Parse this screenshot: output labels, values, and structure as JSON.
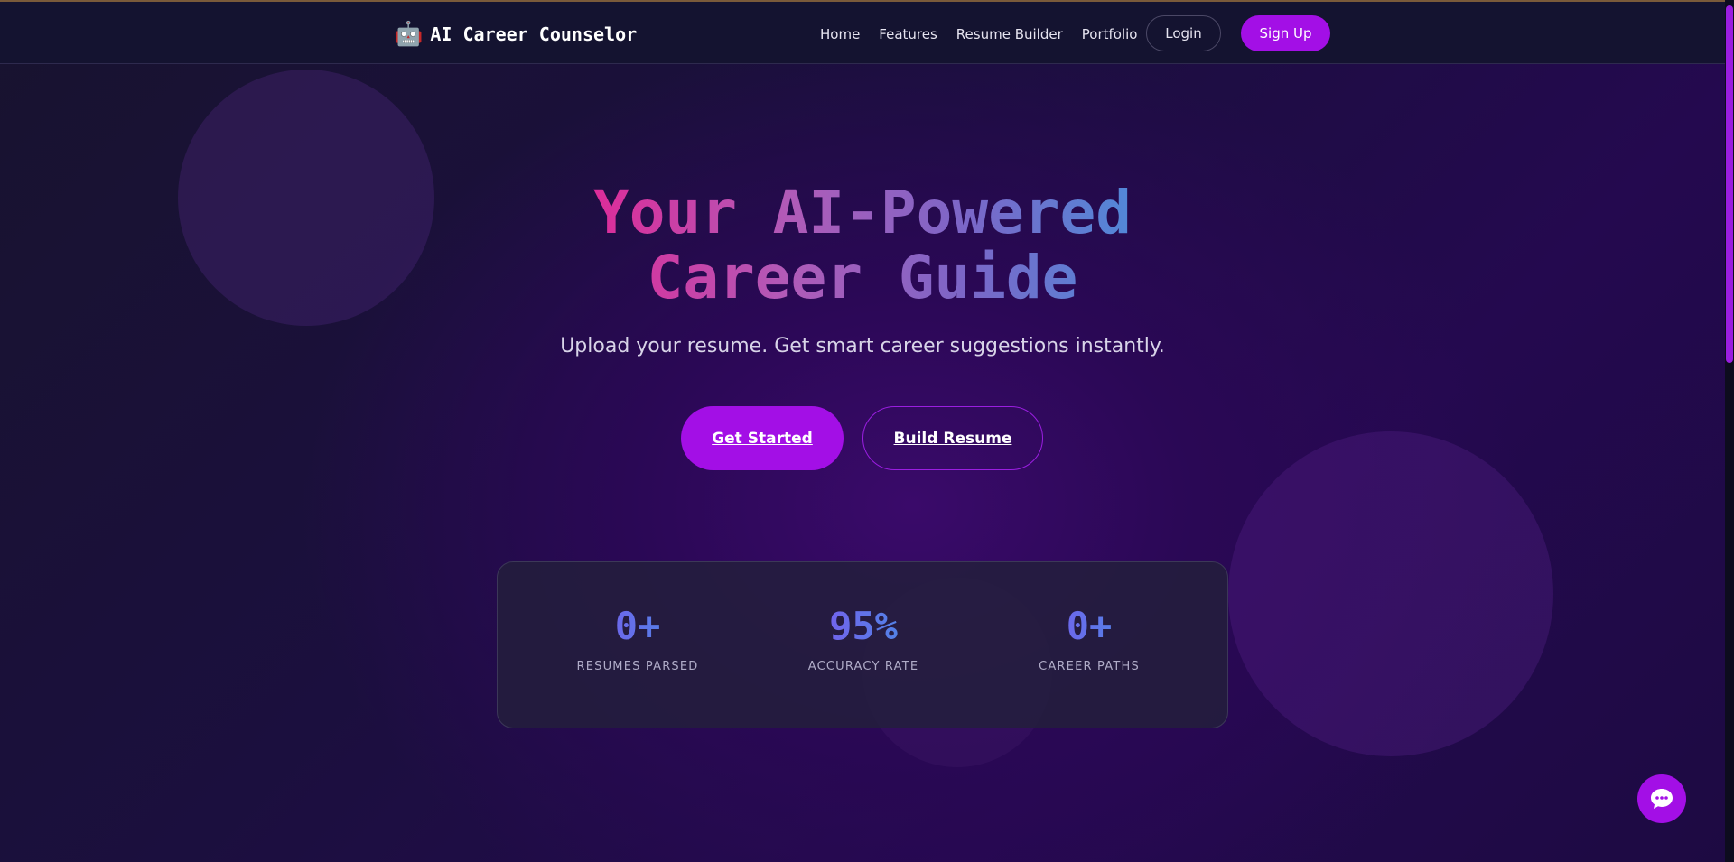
{
  "brand": {
    "icon": "robot-icon",
    "icon_glyph": "🤖",
    "name": "AI Career Counselor"
  },
  "nav": {
    "links": [
      "Home",
      "Features",
      "Resume Builder",
      "Portfolio"
    ],
    "login_label": "Login",
    "signup_label": "Sign Up"
  },
  "hero": {
    "title_line1": "Your AI-Powered",
    "title_line2": "Career Guide",
    "subtitle": "Upload your resume. Get smart career suggestions instantly.",
    "primary_cta": "Get Started",
    "secondary_cta": "Build Resume"
  },
  "stats": [
    {
      "value": "0+",
      "label": "RESUMES PARSED"
    },
    {
      "value": "95%",
      "label": "ACCURACY RATE"
    },
    {
      "value": "0+",
      "label": "CAREER PATHS"
    }
  ],
  "chat": {
    "icon": "chat-bubble-icon"
  },
  "colors": {
    "accent": "#a30fe6",
    "title_gradient_start": "#f0188c",
    "title_gradient_end": "#3c9ae0",
    "navbar_bg": "#141330"
  }
}
